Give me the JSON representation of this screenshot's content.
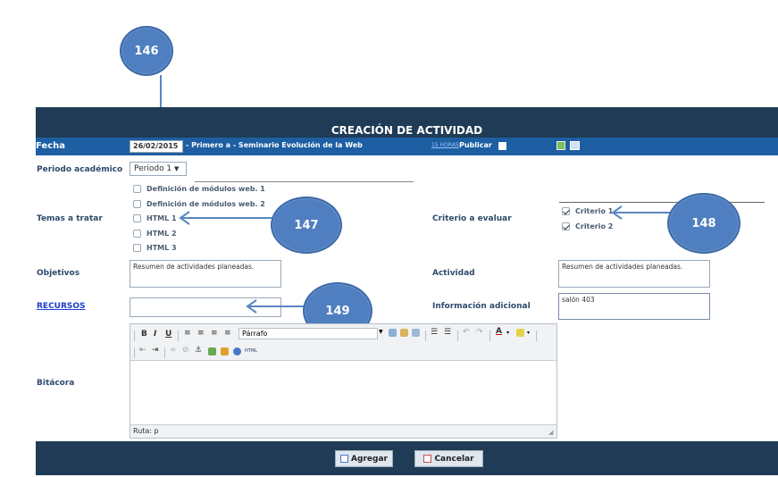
{
  "header": {
    "title": "CREACIÓN DE ACTIVIDAD"
  },
  "bar": {
    "fecha_label": "Fecha",
    "fecha_value": "26/02/2015",
    "course": "- Primero a - Seminario Evolución de la Web",
    "link_text": "15 HORAS",
    "publicar": "Publicar"
  },
  "form": {
    "periodo_label": "Periodo académico",
    "periodo_value": "Periodo 1",
    "temas_label": "Temas a tratar",
    "temas": [
      {
        "label": "Definición de módulos web. 1",
        "checked": false
      },
      {
        "label": "Definición de módulos web. 2",
        "checked": false
      },
      {
        "label": "HTML 1",
        "checked": false
      },
      {
        "label": "HTML 2",
        "checked": false
      },
      {
        "label": "HTML 3",
        "checked": false
      }
    ],
    "criterio_label": "Criterio a evaluar",
    "criterios": [
      {
        "label": "Criterio 1",
        "checked": true
      },
      {
        "label": "Criterio 2",
        "checked": true
      }
    ],
    "objetivos_label": "Objetivos",
    "objetivos_value": "Resumen de actividades planeadas.",
    "actividad_label": "Actividad",
    "actividad_value": "Resumen de actividades planeadas.",
    "recursos_label": "RECURSOS",
    "recursos_value": "",
    "info_label": "Información adicional",
    "info_value": "salón 403",
    "bitacora_label": "Bitácora"
  },
  "editor": {
    "format_value": "Párrafo",
    "path_label": "Ruta: p"
  },
  "buttons": {
    "agregar": "Agregar",
    "cancelar": "Cancelar"
  },
  "callouts": {
    "c146": "146",
    "c147": "147",
    "c148": "148",
    "c149": "149"
  },
  "colors": {
    "header": "#1f3b55",
    "bar": "#1d5fa2",
    "callout": "#4f7fc0",
    "link": "#1a3ccc"
  }
}
